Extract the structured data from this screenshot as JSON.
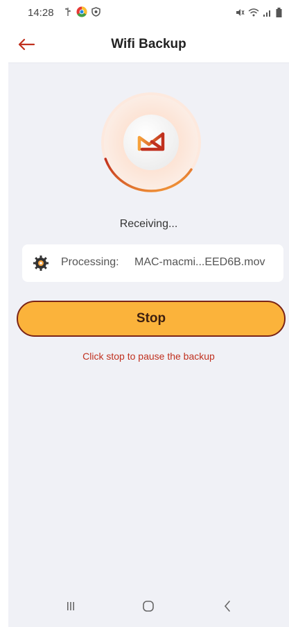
{
  "status_bar": {
    "time": "14:28",
    "left_icons": [
      "usb-icon",
      "chrome-icon",
      "shield-icon"
    ],
    "right_icons": [
      "mute-icon",
      "wifi-icon",
      "signal-icon",
      "battery-icon"
    ]
  },
  "header": {
    "back_icon": "arrow-left-icon",
    "title": "Wifi Backup"
  },
  "main": {
    "status_text": "Receiving...",
    "progress": 0.35,
    "processing": {
      "label": "Processing:",
      "filename": "MAC-macmi...EED6B.mov"
    },
    "stop_button_label": "Stop",
    "hint_text": "Click stop to pause the backup"
  },
  "nav": {
    "recents_icon": "recents-icon",
    "home_icon": "home-icon",
    "back_icon": "back-chevron-icon"
  },
  "colors": {
    "accent": "#c0301e",
    "button": "#fbb33b",
    "button_border": "#7a2417",
    "background": "#f0f1f6"
  }
}
